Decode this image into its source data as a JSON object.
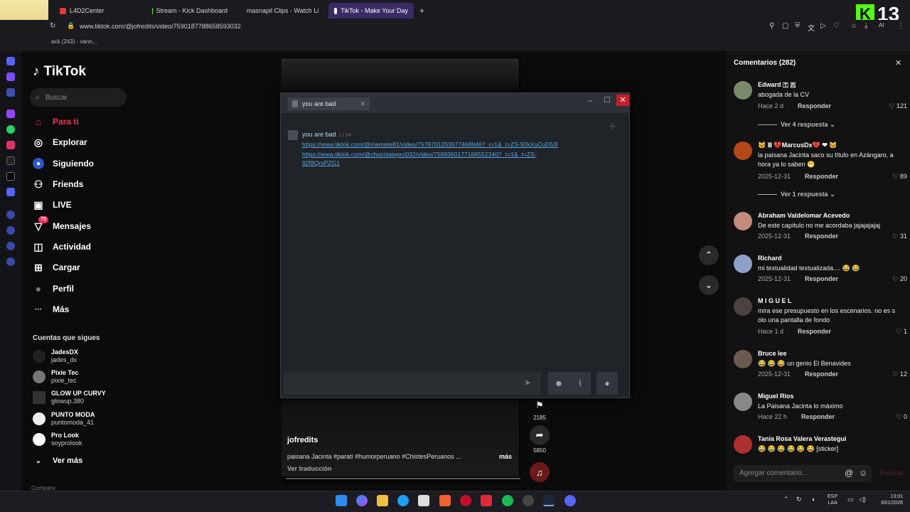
{
  "browser": {
    "tabs": [
      {
        "label": "L4D2Center",
        "color": "#e53935"
      },
      {
        "label": "Stream - Kick Dashboard",
        "color": "#53fc18"
      },
      {
        "label": "masnapil Clips - Watch Li",
        "color": "#53fc18"
      },
      {
        "label": "TikTok - Make Your Day",
        "color": "#ffffff"
      }
    ],
    "new_tab": "+",
    "url": "www.tiktok.com/@jofredits/video/7590187788658593032",
    "bookmark": "ack (243) - vann...",
    "profile_badge": "13",
    "avatar_number": "13",
    "kick_letter": "K"
  },
  "sidebar": {
    "logo": "TikTok",
    "search_placeholder": "Buscar",
    "nav": [
      {
        "label": "Para ti",
        "icon": "home-icon",
        "glyph": "⌂"
      },
      {
        "label": "Explorar",
        "icon": "compass-icon",
        "glyph": "◎"
      },
      {
        "label": "Siguiendo",
        "icon": "following-icon",
        "glyph": "●"
      },
      {
        "label": "Friends",
        "icon": "friends-icon",
        "glyph": "⚇"
      },
      {
        "label": "LIVE",
        "icon": "live-icon",
        "glyph": "▣"
      },
      {
        "label": "Mensajes",
        "icon": "messages-icon",
        "glyph": "▽",
        "badge": "73"
      },
      {
        "label": "Actividad",
        "icon": "activity-icon",
        "glyph": "◫"
      },
      {
        "label": "Cargar",
        "icon": "upload-icon",
        "glyph": "⊞"
      },
      {
        "label": "Perfil",
        "icon": "profile-icon",
        "glyph": "●"
      },
      {
        "label": "Más",
        "icon": "more-icon",
        "glyph": "···"
      }
    ],
    "following_title": "Cuentas que sigues",
    "accounts": [
      {
        "name": "JadesDX",
        "handle": "jades_dx"
      },
      {
        "name": "Pixie Tec",
        "handle": "pixie_tec"
      },
      {
        "name": "GLOW UP CURVY",
        "handle": "glowup.380"
      },
      {
        "name": "PUNTO MODA",
        "handle": "puntomoda_41"
      },
      {
        "name": "Pro Look",
        "handle": "soyprolook"
      }
    ],
    "see_more": "Ver más",
    "company": "Company"
  },
  "video": {
    "author": "jofredits",
    "caption": "paisana Jacinta #parati #humorperuano #ChistesPeruanos ...",
    "more": "más",
    "translate": "Ver traducción",
    "saves": "2185",
    "shares": "5850"
  },
  "chat": {
    "tab_title": "you are bad",
    "sender": "you are bad",
    "time": "12:54",
    "links": [
      "https://www.tiktok.com/@memete81/video/7578701253677468946?_r=1&_t=ZS-92kXuCuD53l",
      "https://www.tiktok.com/@chocolatepro032/video/7589360177166552340?_r=1&_t=ZS-",
      "92f8QrvPZG1"
    ]
  },
  "comments": {
    "title": "Comentarios (282)",
    "input_placeholder": "Agregar comentario...",
    "post": "Publicar",
    "reply_label": "Responder",
    "items": [
      {
        "name": "Edward 🇹 🇷",
        "text": "abogada de la CV",
        "date": "Hace 2 d",
        "likes": "121",
        "replies": "Ver 4 respuesta"
      },
      {
        "name": "🐱 Ⅲ 💔MarcusDx💔 ❤ 🐱",
        "text": "la paisana Jacinta saco su título en Azángaro, a hora ya lo saben 😁",
        "date": "2025-12-31",
        "likes": "89",
        "replies": "Ver 1 respuesta"
      },
      {
        "name": "Abraham Valdelomar Acevedo",
        "text": "De este capítulo no me acordaba jajajajajaj",
        "date": "2025-12-31",
        "likes": "31",
        "replies": ""
      },
      {
        "name": "Richard",
        "text": "mi textualidad textualizada.... 😂 😂",
        "date": "2025-12-31",
        "likes": "20",
        "replies": ""
      },
      {
        "name": "M I G U E L",
        "text": "mira ese presupuesto en los escenarios. no es s olo una pantalla de fondo",
        "date": "Hace 1 d",
        "likes": "1",
        "replies": ""
      },
      {
        "name": "Bruce lee",
        "text": "😂 😂 😂 un genio El Benavides",
        "date": "2025-12-31",
        "likes": "12",
        "replies": ""
      },
      {
        "name": "Miguel Rios",
        "text": "La Paisana Jacinta lo máximo",
        "date": "Hace 22 h",
        "likes": "0",
        "replies": ""
      },
      {
        "name": "Tania Rosa Valera Verastegui",
        "text": "😂 😂 😂 😂 😂 😂 [sticker]",
        "date": "",
        "likes": "",
        "replies": ""
      }
    ]
  },
  "taskbar": {
    "lang_top": "ESP",
    "lang_bottom": "LAA",
    "time": "13:01",
    "date": "3/01/2026"
  }
}
